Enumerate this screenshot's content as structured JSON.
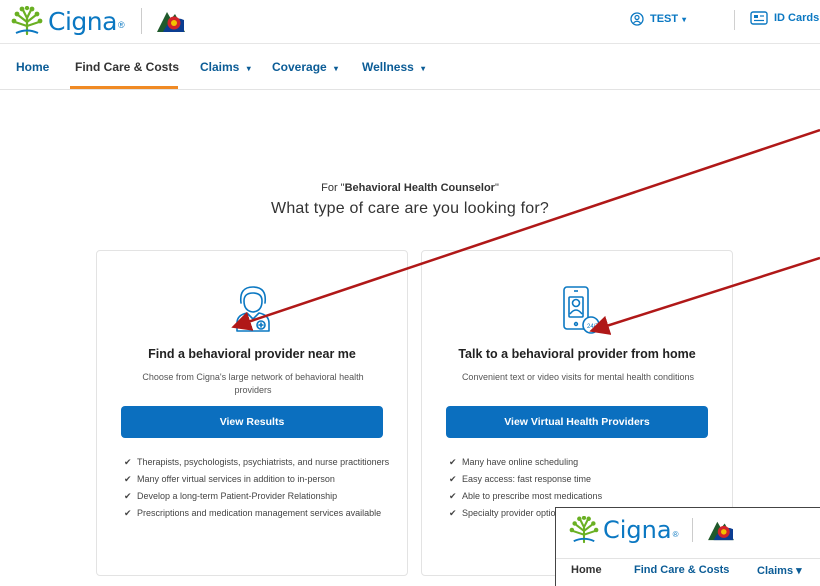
{
  "header": {
    "logo_text": "Cigna",
    "logo_reg": "®",
    "user_label": "TEST",
    "id_cards_label": "ID Cards"
  },
  "nav": {
    "items": [
      {
        "label": "Home",
        "caret": ""
      },
      {
        "label": "Find Care & Costs",
        "caret": ""
      },
      {
        "label": "Claims",
        "caret": "▾"
      },
      {
        "label": "Coverage",
        "caret": "▾"
      },
      {
        "label": "Wellness",
        "caret": "▾"
      }
    ],
    "active": "Find Care & Costs"
  },
  "search": {
    "for_prefix": "For \"",
    "term": "Behavioral Health Counselor",
    "for_suffix": "\"",
    "question": "What type of care are you looking for?"
  },
  "cards": [
    {
      "title": "Find a behavioral provider near me",
      "description": "Choose from Cigna's large network of behavioral health providers",
      "button_label": "View Results",
      "features": [
        "Therapists, psychologists, psychiatrists, and nurse practitioners",
        "Many offer virtual services in addition to in-person",
        "Develop a long-term Patient-Provider Relationship",
        "Prescriptions and medication management services available"
      ]
    },
    {
      "title": "Talk to a behavioral provider from home",
      "description": "Convenient text or video visits for mental health conditions",
      "button_label": "View Virtual Health Providers",
      "features": [
        "Many have online scheduling",
        "Easy access: fast response time",
        "Able to prescribe most medications",
        "Specialty provider options for OCD, Addiction"
      ]
    }
  ],
  "inset": {
    "logo_text": "Cigna",
    "logo_reg": "®",
    "nav_items": [
      "Home",
      "Find Care & Costs",
      "Claims ▾"
    ]
  },
  "colors": {
    "brand_blue": "#0b78c2",
    "button_blue": "#0b6fbf",
    "nav_blue": "#0b5c96",
    "active_underline": "#f08a24",
    "annotation_arrow": "#b01818"
  }
}
